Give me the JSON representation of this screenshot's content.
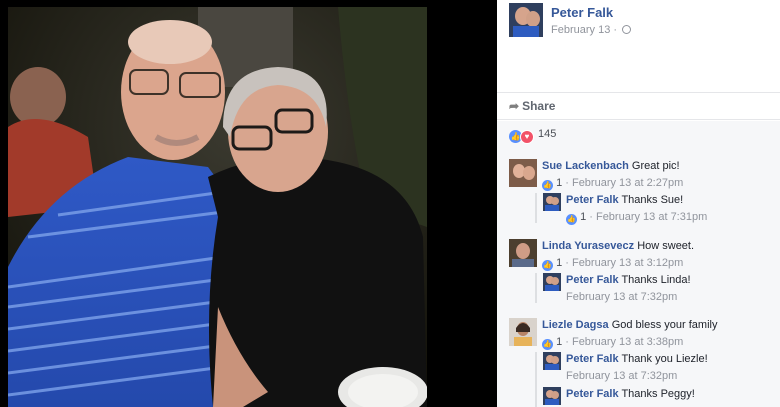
{
  "post": {
    "author": "Peter Falk",
    "date": "February 13",
    "share_label": "Share",
    "reaction_count": "145",
    "reaction_icons": [
      "like-icon",
      "love-icon"
    ]
  },
  "comments": [
    {
      "name": "Sue Lackenbach",
      "text": "Great pic!",
      "likes": "1",
      "meta": "February 13 at 2:27pm"
    },
    {
      "name": "Peter Falk",
      "text": "Thanks Sue!",
      "likes": "1",
      "meta": "February 13 at 7:31pm"
    },
    {
      "name": "Linda Yurasevecz",
      "text": "How sweet.",
      "likes": "1",
      "meta": "February 13 at 3:12pm"
    },
    {
      "name": "Peter Falk",
      "text": "Thanks Linda!",
      "meta": "February 13 at 7:32pm"
    },
    {
      "name": "Liezle Dagsa",
      "text": "God bless your family",
      "likes": "1",
      "meta": "February 13 at 3:38pm"
    },
    {
      "name": "Peter Falk",
      "text": "Thank you Liezle!",
      "meta": "February 13 at 7:32pm"
    },
    {
      "name": "Peter Falk",
      "text": "Thanks Peggy!"
    }
  ],
  "colors": {
    "link": "#365899",
    "meta": "#90949c",
    "like": "#5890ff",
    "love": "#f25268",
    "panel_bg": "#f6f7f9"
  }
}
